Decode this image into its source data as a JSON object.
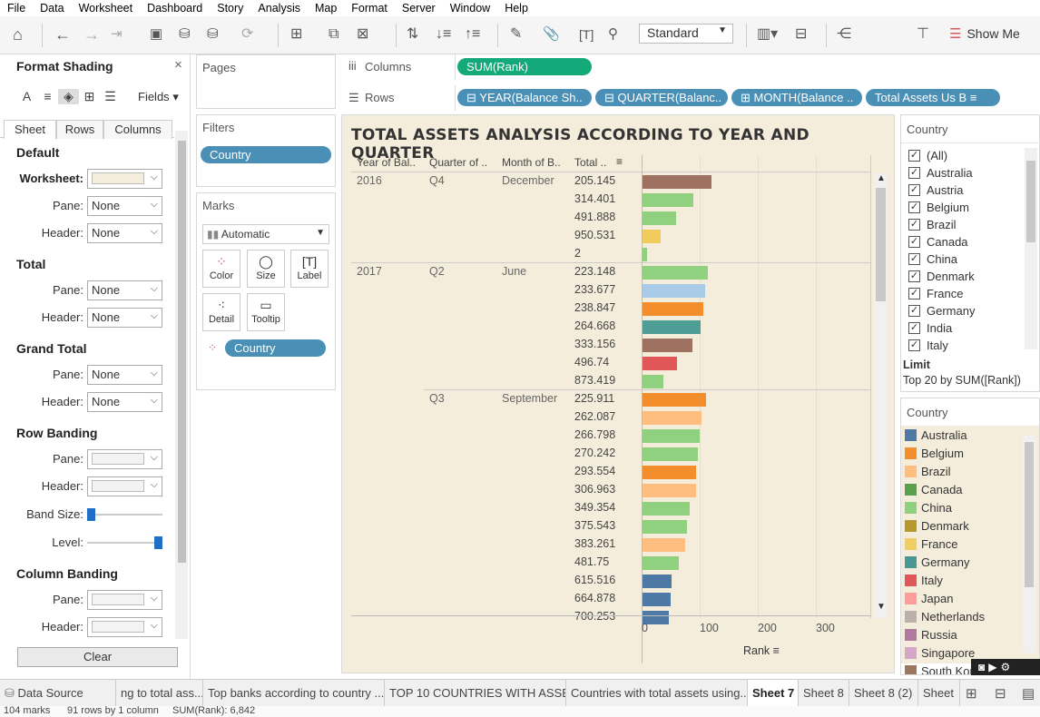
{
  "menu": [
    "File",
    "Data",
    "Worksheet",
    "Dashboard",
    "Story",
    "Analysis",
    "Map",
    "Format",
    "Server",
    "Window",
    "Help"
  ],
  "toolbar": {
    "fit_mode": "Standard",
    "show_me": "Show Me"
  },
  "format_panel": {
    "title": "Format Shading",
    "fields_label": "Fields",
    "tabs": [
      "Sheet",
      "Rows",
      "Columns"
    ],
    "sections": {
      "default": "Default",
      "worksheet": "Worksheet:",
      "pane": "Pane:",
      "header": "Header:",
      "total": "Total",
      "grand_total": "Grand Total",
      "row_banding": "Row Banding",
      "band_size": "Band Size:",
      "level": "Level:",
      "column_banding": "Column Banding"
    },
    "none": "None",
    "clear": "Clear"
  },
  "pages": {
    "title": "Pages"
  },
  "filters": {
    "title": "Filters",
    "pill": "Country"
  },
  "marks": {
    "title": "Marks",
    "type": "Automatic",
    "buttons": [
      "Color",
      "Size",
      "Label",
      "Detail",
      "Tooltip"
    ],
    "pill": "Country"
  },
  "shelves": {
    "columns_label": "Columns",
    "columns_pill": "SUM(Rank)",
    "rows_label": "Rows",
    "rows_pills": [
      "YEAR(Balance Sh..",
      "QUARTER(Balanc..",
      "MONTH(Balance ..",
      "Total Assets Us B"
    ]
  },
  "viz": {
    "title": "TOTAL ASSETS ANALYSIS ACCORDING TO YEAR AND QUARTER",
    "headers": [
      "Year of Bal..",
      "Quarter of ..",
      "Month of B..",
      "Total .."
    ],
    "groups": [
      {
        "year": "2016",
        "quarter": "Q4",
        "month": "December"
      },
      {
        "year": "2017",
        "quarter": "Q2",
        "month": "June"
      },
      {
        "year": "",
        "quarter": "Q3",
        "month": "September"
      }
    ],
    "rows": [
      "205.145",
      "314.401",
      "491.888",
      "950.531",
      "2",
      "223.148",
      "233.677",
      "238.847",
      "264.668",
      "333.156",
      "496.74",
      "873.419",
      "225.911",
      "262.087",
      "266.798",
      "270.242",
      "293.554",
      "306.963",
      "349.354",
      "375.543",
      "383.261",
      "481.75",
      "615.516",
      "664.878",
      "700.253"
    ],
    "axis_ticks": [
      "0",
      "100",
      "200",
      "300"
    ],
    "axis_title": "Rank"
  },
  "chart_data": {
    "type": "bar",
    "title": "TOTAL ASSETS ANALYSIS ACCORDING TO YEAR AND QUARTER",
    "xlabel": "Rank",
    "xlim": [
      0,
      370
    ],
    "categories": [
      "205.145",
      "314.401",
      "491.888",
      "950.531",
      "2",
      "223.148",
      "233.677",
      "238.847",
      "264.668",
      "333.156",
      "496.74",
      "873.419",
      "225.911",
      "262.087",
      "266.798",
      "270.242",
      "293.554",
      "306.963",
      "349.354",
      "375.543",
      "383.261",
      "481.75",
      "615.516",
      "664.878",
      "700.253"
    ],
    "values": [
      118,
      88,
      58,
      32,
      8,
      112,
      108,
      104,
      100,
      86,
      60,
      36,
      110,
      102,
      98,
      96,
      92,
      92,
      82,
      76,
      74,
      62,
      50,
      48,
      46
    ],
    "bar_colors": [
      "#9e7160",
      "#8fd17f",
      "#8fd17f",
      "#f1cc5d",
      "#8fd17f",
      "#8fd17f",
      "#a8cbe8",
      "#f28e2b",
      "#4e9e96",
      "#9e7160",
      "#e15759",
      "#8fd17f",
      "#f28e2b",
      "#ffbd80",
      "#8fd17f",
      "#8fd17f",
      "#f28e2b",
      "#ffbd80",
      "#8fd17f",
      "#8fd17f",
      "#ffbd80",
      "#8fd17f",
      "#4e79a7",
      "#4e79a7",
      "#4e79a7"
    ]
  },
  "country_filter": {
    "title": "Country",
    "items": [
      "(All)",
      "Australia",
      "Austria",
      "Belgium",
      "Brazil",
      "Canada",
      "China",
      "Denmark",
      "France",
      "Germany",
      "India",
      "Italy"
    ],
    "limit_title": "Limit",
    "limit_text": "Top 20 by SUM([Rank])"
  },
  "country_legend": {
    "title": "Country",
    "items": [
      {
        "name": "Australia",
        "color": "#4e79a7"
      },
      {
        "name": "Belgium",
        "color": "#f28e2b"
      },
      {
        "name": "Brazil",
        "color": "#ffbd80"
      },
      {
        "name": "Canada",
        "color": "#59a14f"
      },
      {
        "name": "China",
        "color": "#8fd17f"
      },
      {
        "name": "Denmark",
        "color": "#b6992d"
      },
      {
        "name": "France",
        "color": "#f1ce63"
      },
      {
        "name": "Germany",
        "color": "#499894"
      },
      {
        "name": "Italy",
        "color": "#e15759"
      },
      {
        "name": "Japan",
        "color": "#ff9d9a"
      },
      {
        "name": "Netherlands",
        "color": "#bab0ac"
      },
      {
        "name": "Russia",
        "color": "#b07aa1"
      },
      {
        "name": "Singapore",
        "color": "#d4a6c8"
      },
      {
        "name": "South Kor..",
        "color": "#9d7660"
      }
    ]
  },
  "sheet_tabs": [
    "Data Source",
    "ng to total ass...",
    "Top banks according to country ...",
    "TOP 10 COUNTRIES WITH ASSE...",
    "Countries with total assets using...",
    "Sheet 7",
    "Sheet 8",
    "Sheet 8 (2)",
    "Sheet"
  ],
  "status": {
    "marks": "104 marks",
    "rows": "91 rows by 1 column",
    "sum": "SUM(Rank): 6,842"
  }
}
